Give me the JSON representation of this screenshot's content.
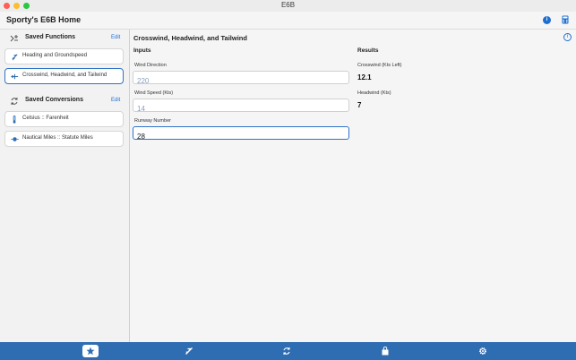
{
  "window": {
    "title": "E6B"
  },
  "header": {
    "title": "Sporty's E6B Home"
  },
  "sidebar": {
    "saved_functions": {
      "title": "Saved Functions",
      "edit_label": "Edit",
      "items": [
        {
          "label": "Heading and Groundspeed",
          "icon": "airplane-icon"
        },
        {
          "label": "Crosswind, Headwind, and Tailwind",
          "icon": "wind-icon"
        }
      ]
    },
    "saved_conversions": {
      "title": "Saved Conversions",
      "edit_label": "Edit",
      "items": [
        {
          "label": "Celsius :: Farenheit",
          "icon": "thermometer-icon"
        },
        {
          "label": "Nautical Miles :: Statute Miles",
          "icon": "distance-icon"
        }
      ]
    }
  },
  "main": {
    "title": "Crosswind, Headwind, and Tailwind",
    "inputs_heading": "Inputs",
    "results_heading": "Results",
    "inputs": [
      {
        "label": "Wind Direction",
        "value": "",
        "placeholder": "220"
      },
      {
        "label": "Wind Speed (Kts)",
        "value": "",
        "placeholder": "14"
      },
      {
        "label": "Runway Number",
        "value": "28",
        "placeholder": ""
      }
    ],
    "results": [
      {
        "label": "Crosswind (Kts Left)",
        "value": "12.1"
      },
      {
        "label": "Headwind (Kts)",
        "value": "7"
      }
    ]
  },
  "tabbar": {
    "tabs": [
      {
        "icon": "star-icon",
        "selected": true
      },
      {
        "icon": "airplane-icon",
        "selected": false
      },
      {
        "icon": "convert-icon",
        "selected": false
      },
      {
        "icon": "bag-icon",
        "selected": false
      },
      {
        "icon": "gear-icon",
        "selected": false
      }
    ]
  },
  "colors": {
    "accent": "#2f6db3",
    "link": "#1f6fd1"
  }
}
